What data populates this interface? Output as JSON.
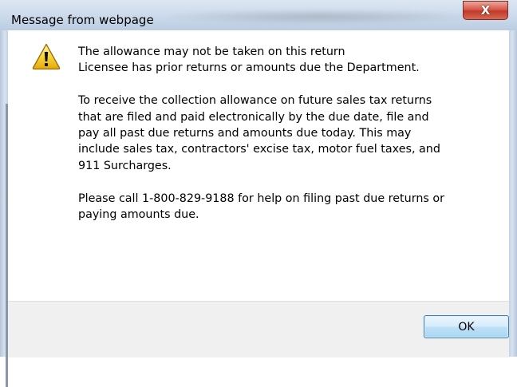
{
  "dialog": {
    "title": "Message from webpage",
    "close_label": "X",
    "icon": "warning-icon",
    "message": {
      "line1": "The allowance may not be taken on this return",
      "line2": "Licensee has prior returns or amounts due the Department.",
      "para2_line1": "To receive the collection allowance on future sales tax returns",
      "para2_line2": "that are filed and paid electronically by the due date, file and",
      "para2_line3": "pay all past due returns and amounts due today. This may",
      "para2_line4": "include sales tax, contractors' excise tax, motor fuel taxes, and",
      "para2_line5": "911 Surcharges.",
      "para3_line1": "Please call 1-800-829-9188 for help on filing past due returns or",
      "para3_line2": "paying amounts due."
    },
    "ok_label": "OK"
  }
}
